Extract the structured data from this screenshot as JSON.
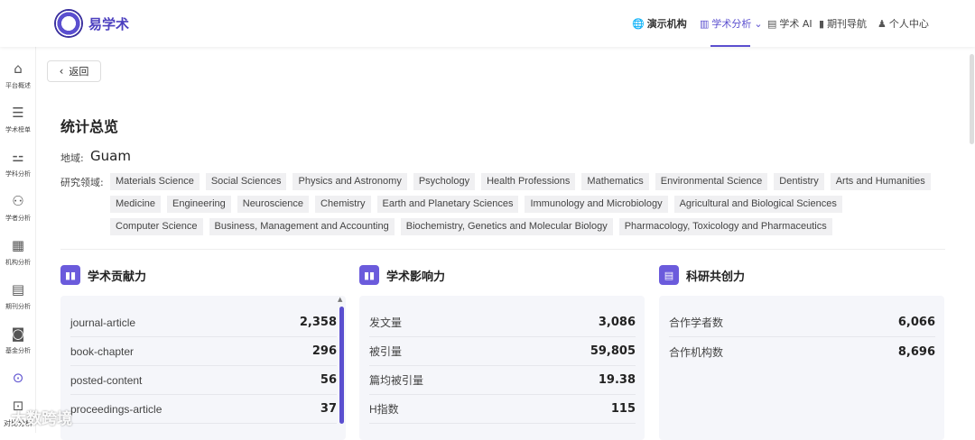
{
  "brand": "易学术",
  "nav": {
    "org": "演示机构",
    "analysis": "学术分析",
    "ai": "学术 AI",
    "journal": "期刊导航",
    "personal": "个人中心"
  },
  "sidebar": [
    {
      "icon": "home-icon",
      "label": "平台概述"
    },
    {
      "icon": "list-icon",
      "label": "学术榜单"
    },
    {
      "icon": "hierarchy-icon",
      "label": "学科分析"
    },
    {
      "icon": "people-icon",
      "label": "学者分析"
    },
    {
      "icon": "building-icon",
      "label": "机构分析"
    },
    {
      "icon": "journal-icon",
      "label": "期刊分析"
    },
    {
      "icon": "money-icon",
      "label": "基金分析"
    },
    {
      "icon": "location-icon",
      "label": ""
    },
    {
      "icon": "chart-icon",
      "label": "对比分析"
    }
  ],
  "back_label": "返回",
  "page_title": "统计总览",
  "region": {
    "label": "地域:",
    "value": "Guam"
  },
  "fields": {
    "label": "研究领域:",
    "tags": [
      "Materials Science",
      "Social Sciences",
      "Physics and Astronomy",
      "Psychology",
      "Health Professions",
      "Mathematics",
      "Environmental Science",
      "Dentistry",
      "Arts and Humanities",
      "Medicine",
      "Engineering",
      "Neuroscience",
      "Chemistry",
      "Earth and Planetary Sciences",
      "Immunology and Microbiology",
      "Agricultural and Biological Sciences",
      "Computer Science",
      "Business, Management and Accounting",
      "Biochemistry, Genetics and Molecular Biology",
      "Pharmacology, Toxicology and Pharmaceutics"
    ]
  },
  "cards": [
    {
      "title": "学术贡献力",
      "rows": [
        {
          "label": "journal-article",
          "value": "2,358"
        },
        {
          "label": "book-chapter",
          "value": "296"
        },
        {
          "label": "posted-content",
          "value": "56"
        },
        {
          "label": "proceedings-article",
          "value": "37"
        }
      ]
    },
    {
      "title": "学术影响力",
      "rows": [
        {
          "label": "发文量",
          "value": "3,086"
        },
        {
          "label": "被引量",
          "value": "59,805"
        },
        {
          "label": "篇均被引量",
          "value": "19.38"
        },
        {
          "label": "H指数",
          "value": "115"
        }
      ]
    },
    {
      "title": "科研共创力",
      "rows": [
        {
          "label": "合作学者数",
          "value": "6,066"
        },
        {
          "label": "合作机构数",
          "value": "8,696"
        }
      ]
    }
  ],
  "watermark": "大数跨境"
}
